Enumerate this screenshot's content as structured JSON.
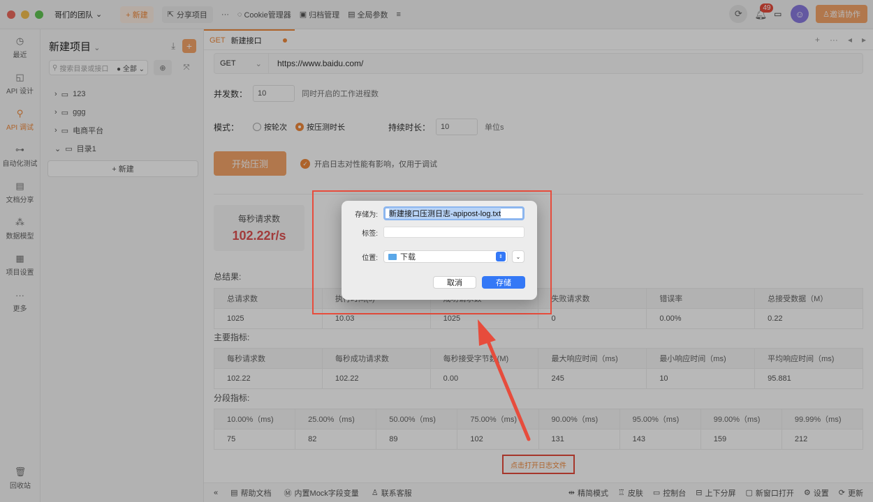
{
  "topbar": {
    "team": "哥们的团队",
    "new_label": "+ 新建",
    "share_label": "分享项目",
    "more": "···",
    "cookie": "Cookie管理器",
    "archive": "归档管理",
    "global_params": "全局参数",
    "badge_count": "49",
    "invite": "邀请协作"
  },
  "rail": {
    "items": [
      {
        "label": "最近",
        "icon": "clock-icon"
      },
      {
        "label": "API 设计",
        "icon": "design-icon"
      },
      {
        "label": "API 调试",
        "icon": "debug-icon"
      },
      {
        "label": "自动化测试",
        "icon": "flow-icon"
      },
      {
        "label": "文档分享",
        "icon": "doc-icon"
      },
      {
        "label": "数据模型",
        "icon": "model-icon"
      },
      {
        "label": "项目设置",
        "icon": "settings-icon"
      },
      {
        "label": "更多",
        "icon": "more-icon"
      }
    ],
    "trash": "回收站"
  },
  "panel": {
    "title": "新建项目",
    "search_placeholder": "搜索目录或接口",
    "filter": "全部",
    "tree": [
      "123",
      "ggg",
      "电商平台",
      "目录1"
    ],
    "new_label": "+ 新建"
  },
  "tab": {
    "method": "GET",
    "name": "新建接口"
  },
  "request": {
    "method": "GET",
    "url": "https://www.baidu.com/"
  },
  "form": {
    "concurrency_label": "并发数：",
    "concurrency_value": "10",
    "concurrency_hint": "同时开启的工作进程数",
    "mode_label": "模式：",
    "mode_round": "按轮次",
    "mode_duration": "按压测时长",
    "duration_label": "持续时长：",
    "duration_value": "10",
    "duration_unit": "单位s",
    "start_button": "开始压测",
    "log_hint": "开启日志对性能有影响，仅用于调试"
  },
  "stat": {
    "label": "每秒请求数",
    "value": "102.22r/s"
  },
  "summary": {
    "title": "总结果:",
    "headers": [
      "总请求数",
      "执行时间(s)",
      "成功请求数",
      "失败请求数",
      "错误率",
      "总接受数据（M）"
    ],
    "values": [
      "1025",
      "10.03",
      "1025",
      "0",
      "0.00%",
      "0.22"
    ]
  },
  "metrics": {
    "title": "主要指标:",
    "headers": [
      "每秒请求数",
      "每秒成功请求数",
      "每秒接受字节数(M)",
      "最大响应时间（ms)",
      "最小响应时间（ms)",
      "平均响应时间（ms)"
    ],
    "values": [
      "102.22",
      "102.22",
      "0.00",
      "245",
      "10",
      "95.881"
    ]
  },
  "percentiles": {
    "title": "分段指标:",
    "headers": [
      "10.00%（ms)",
      "25.00%（ms)",
      "50.00%（ms)",
      "75.00%（ms)",
      "90.00%（ms)",
      "95.00%（ms)",
      "99.00%（ms)",
      "99.99%（ms)"
    ],
    "values": [
      "75",
      "82",
      "89",
      "102",
      "131",
      "143",
      "159",
      "212"
    ]
  },
  "open_log": "点击打开日志文件",
  "bottombar": {
    "help": "帮助文档",
    "mock": "内置Mock字段变量",
    "support": "联系客服",
    "simple": "精简模式",
    "skin": "皮肤",
    "console": "控制台",
    "split": "上下分屏",
    "new_window": "新窗口打开",
    "settings": "设置",
    "update": "更新"
  },
  "dialog": {
    "save_as_label": "存储为:",
    "filename": "新建接口压测日志-apipost-log.txt",
    "tags_label": "标签:",
    "location_label": "位置:",
    "location": "下载",
    "cancel": "取消",
    "save": "存储"
  },
  "colors": {
    "accent": "#f08a3c",
    "annotation": "#e74c3c",
    "mac_blue": "#3478f6"
  }
}
